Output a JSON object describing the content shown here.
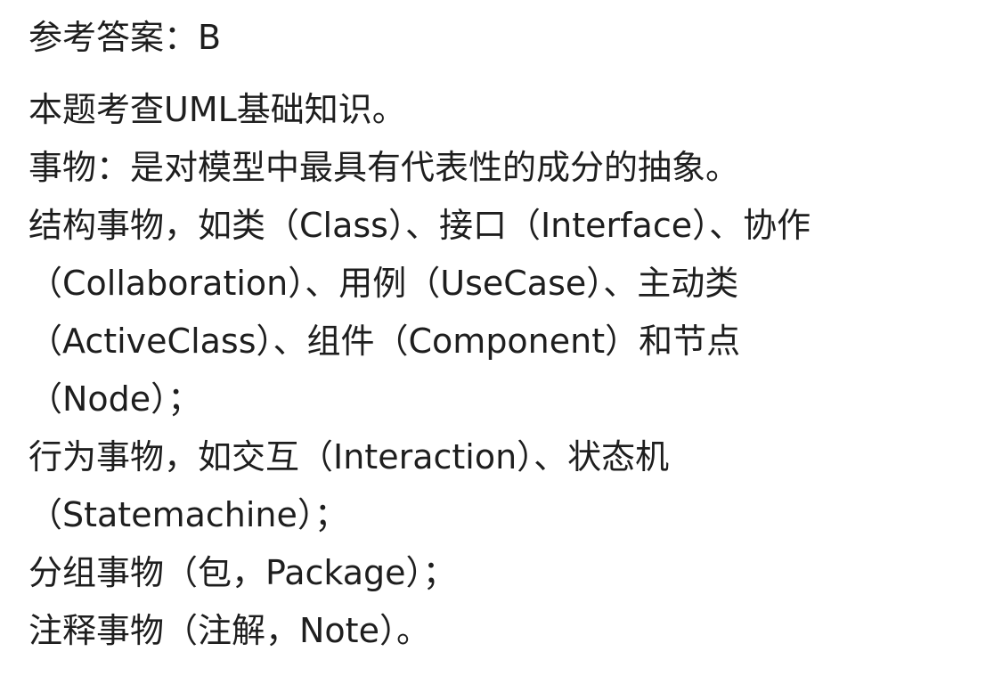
{
  "answer": {
    "label": "参考答案：",
    "value": "B"
  },
  "explanation": {
    "lines": [
      "本题考查UML基础知识。",
      "事物：是对模型中最具有代表性的成分的抽象。",
      "结构事物，如类（Class）、接口（Interface）、协作",
      "（Collaboration）、用例（UseCase）、主动类",
      "（ActiveClass）、组件（Component）和节点",
      "（Node）；",
      "行为事物，如交互（Interaction）、状态机",
      "（Statemachine）；",
      "分组事物（包，Package）；",
      "注释事物（注解，Note）。"
    ]
  }
}
